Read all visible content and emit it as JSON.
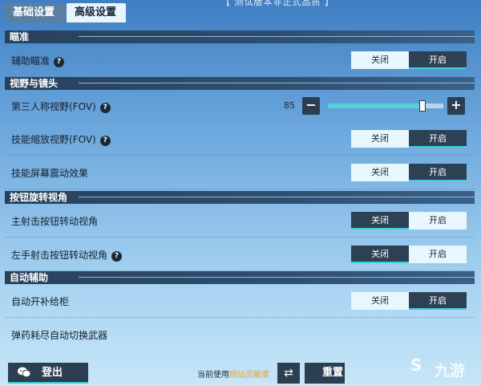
{
  "tabs": {
    "basic": "基础设置",
    "advanced": "高级设置"
  },
  "banner": "【 测试版本非正式品质 】",
  "sections": {
    "aim": "瞄准",
    "view": "视野与镜头",
    "button_rotate": "按钮旋转视角",
    "auto_assist": "自动辅助"
  },
  "rows": {
    "aim_assist": {
      "label": "辅助瞄准",
      "off": "关闭",
      "on": "开启",
      "selected": "on"
    },
    "third_person_fov": {
      "label": "第三人称视野(FOV)",
      "value": "85",
      "minus": "−",
      "plus": "+",
      "level": 0.82
    },
    "skill_zoom_fov": {
      "label": "技能缩放视野(FOV)",
      "off": "关闭",
      "on": "开启",
      "selected": "on"
    },
    "skill_shake": {
      "label": "技能屏幕震动效果",
      "off": "关闭",
      "on": "开启",
      "selected": "on"
    },
    "main_fire_rotate": {
      "label": "主射击按钮转动视角",
      "off": "关闭",
      "on": "开启",
      "selected": "off"
    },
    "left_fire_rotate": {
      "label": "左手射击按钮转动视角",
      "off": "关闭",
      "on": "开启",
      "selected": "off"
    },
    "auto_supply": {
      "label": "自动开补给柜",
      "off": "关闭",
      "on": "开启",
      "selected": "on"
    },
    "auto_switch_weapon": {
      "label": "弹药耗尽自动切换武器"
    }
  },
  "help_glyph": "?",
  "bottom": {
    "logout": "登出",
    "sens_prefix": "当前使用",
    "sens_name": "顺仙灵敏度",
    "swap_glyph": "⇄",
    "reset": "重置"
  },
  "watermark": {
    "mark": "S",
    "text": "九游"
  },
  "colors": {
    "accent": "#3fd0d7",
    "dark_button": "#2c3f52",
    "light_option": "#e8f6fd",
    "highlight": "#e0a23a"
  }
}
